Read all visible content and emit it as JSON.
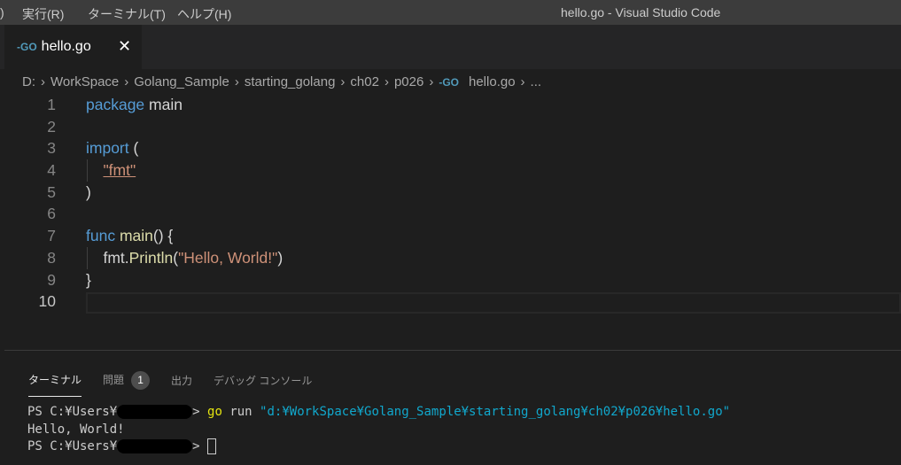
{
  "titlebar": {
    "menus": [
      ")",
      "実行(R)",
      "ターミナル(T)",
      "ヘルプ(H)"
    ],
    "window_title": "hello.go - Visual Studio Code"
  },
  "tab": {
    "icon": "-GO",
    "label": "hello.go",
    "close": "✕"
  },
  "breadcrumb": [
    "D:",
    "WorkSpace",
    "Golang_Sample",
    "starting_golang",
    "ch02",
    "p026",
    "hello.go",
    "..."
  ],
  "editor": {
    "line_numbers": [
      "1",
      "2",
      "3",
      "4",
      "5",
      "6",
      "7",
      "8",
      "9",
      "10"
    ],
    "code": {
      "l1_kw": "package",
      "l1_rest": " main",
      "l3_kw": "import",
      "l3_rest": " (",
      "l4_str": "\"fmt\"",
      "l5": ")",
      "l7_kw": "func",
      "l7_fn": " main",
      "l7_rest": "() {",
      "l8_pkg": "fmt.",
      "l8_fn": "Println",
      "l8_open": "(",
      "l8_str": "\"Hello, World!\"",
      "l8_close": ")",
      "l9": "}"
    }
  },
  "panel": {
    "tabs": [
      "ターミナル",
      "問題",
      "出力",
      "デバッグ コンソール"
    ],
    "problems_count": "1"
  },
  "terminal": {
    "prompt": "PS C:¥Users¥",
    "prompt_end": ">",
    "cmd_go": "go",
    "cmd_run": " run ",
    "cmd_path": "\"d:¥WorkSpace¥Golang_Sample¥starting_golang¥ch02¥p026¥hello.go\"",
    "output": "Hello, World!"
  }
}
